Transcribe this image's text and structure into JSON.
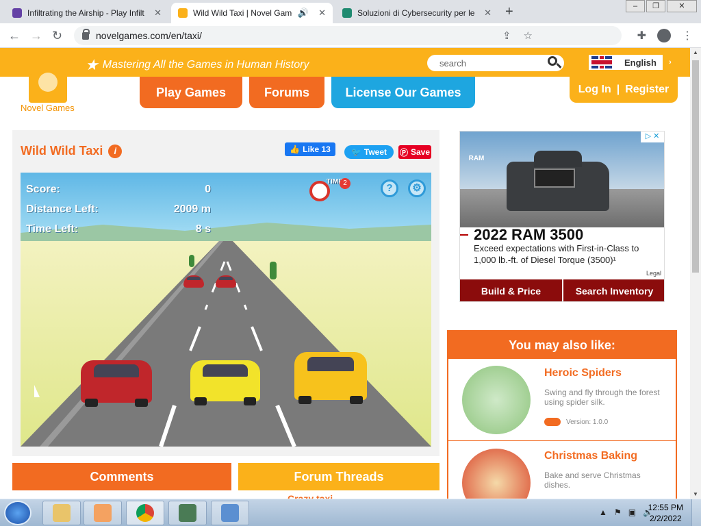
{
  "browser": {
    "tabs": [
      {
        "title": "Infiltrating the Airship - Play Infilt",
        "color": "#6441a5"
      },
      {
        "title": "Wild Wild Taxi | Novel Games",
        "color": "#fbb11a"
      },
      {
        "title": "Soluzioni di Cybersecurity per le",
        "color": "#1f8a70"
      }
    ],
    "url": "novelgames.com/en/taxi/"
  },
  "site": {
    "logo_name": "Novel Games",
    "tagline": "Mastering All the Games in Human History",
    "search_placeholder": "search",
    "language": "English",
    "nav": [
      "Play Games",
      "Forums",
      "License Our Games"
    ],
    "login": "Log In",
    "separator": "|",
    "register": "Register"
  },
  "game_panel": {
    "title": "Wild Wild Taxi",
    "fb_like": "Like 13",
    "tweet": "Tweet",
    "save": "Save"
  },
  "game": {
    "score_label": "Score:",
    "score": "0",
    "distance_label": "Distance Left:",
    "distance": "2009 m",
    "time_label": "Time Left:",
    "time": "8 s",
    "time_badge": "2",
    "time_icon_label": "TIME",
    "help": "?",
    "settings": "⚙"
  },
  "ad": {
    "brand": "RAM",
    "headline": "2022 RAM 3500",
    "text": "Exceed expectations with First-in-Class to 1,000 lb.-ft. of Diesel Torque (3500)¹",
    "legal": "Legal",
    "btn1": "Build & Price",
    "btn2": "Search Inventory"
  },
  "recommend": {
    "header": "You may also like:",
    "items": [
      {
        "title": "Heroic Spiders",
        "desc": "Swing and fly through the forest using spider silk.",
        "version": "Version: 1.0.0"
      },
      {
        "title": "Christmas Baking",
        "desc": "Bake and serve Christmas dishes."
      }
    ]
  },
  "bottom": {
    "comments": "Comments",
    "forum": "Forum Threads",
    "forum_first": "Crazy taxi"
  },
  "taskbar": {
    "time": "12:55 PM",
    "date": "2/2/2022"
  }
}
